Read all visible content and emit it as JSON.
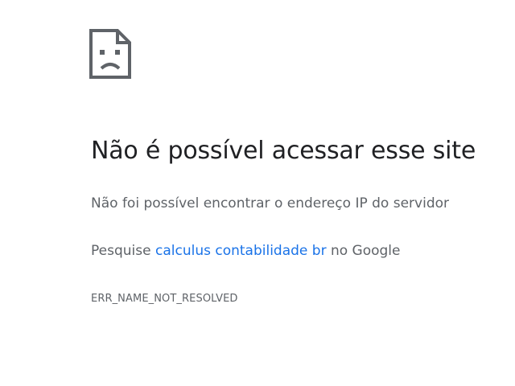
{
  "error_icon": "sad-page-icon",
  "title": "Não é possível acessar esse site",
  "detail": "Não foi possível encontrar o endereço IP do servidor",
  "suggestion": {
    "prefix": "Pesquise ",
    "link": "calculus contabilidade br",
    "suffix": " no Google"
  },
  "error_code": "ERR_NAME_NOT_RESOLVED",
  "colors": {
    "title": "#202124",
    "text": "#5f6368",
    "link": "#1a73e8",
    "icon": "#5f6368"
  }
}
